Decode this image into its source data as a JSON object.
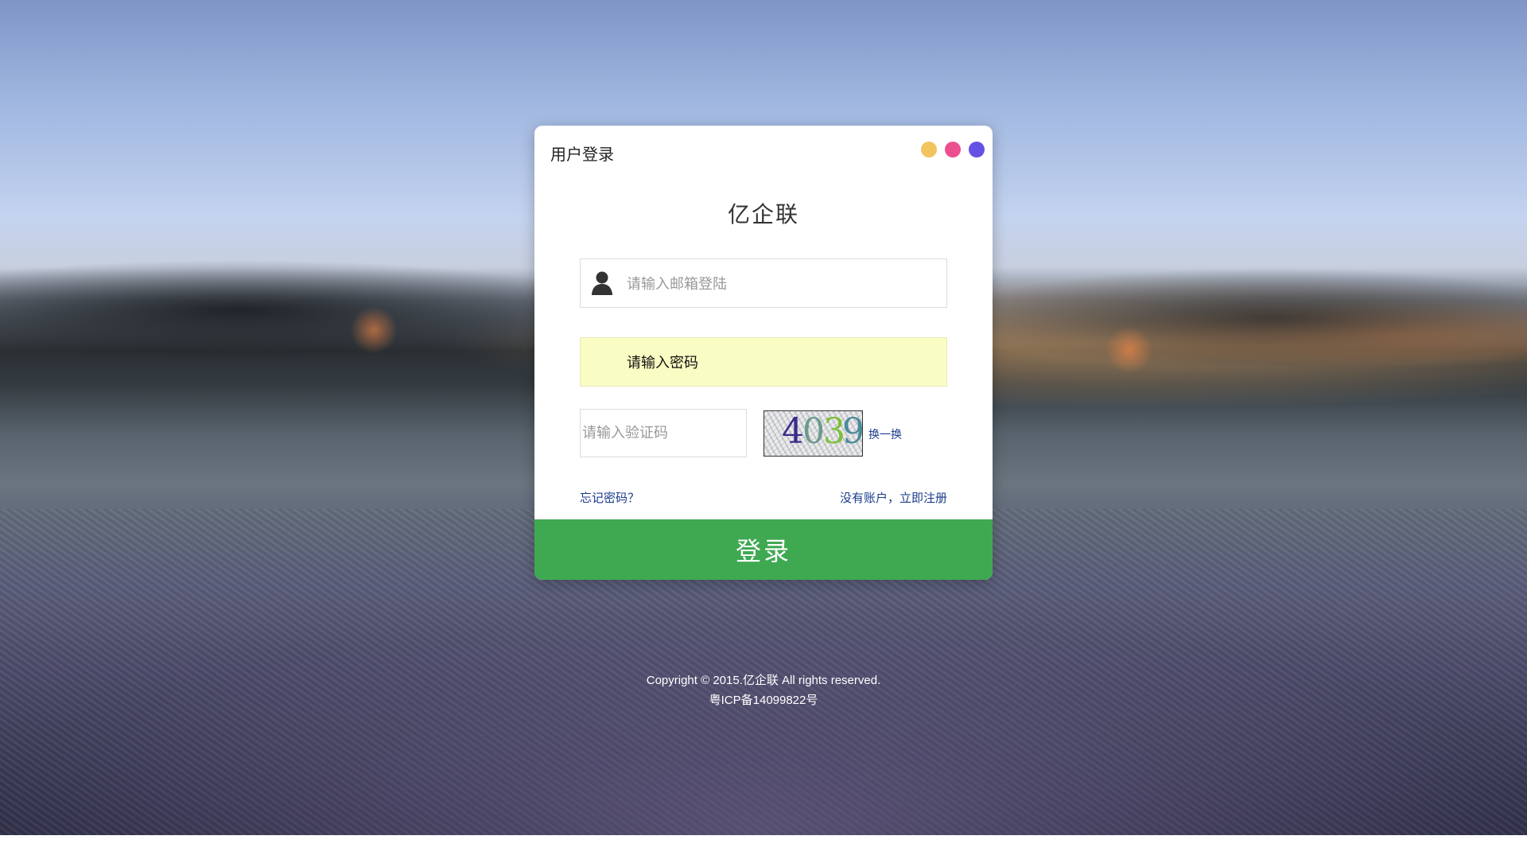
{
  "login": {
    "window_title": "用户登录",
    "brand": "亿企联",
    "email_placeholder": "请输入邮箱登陆",
    "password_placeholder": "请输入密码",
    "captcha_placeholder": "请输入验证码",
    "captcha_code": [
      "4",
      "0",
      "3",
      "9"
    ],
    "refresh_captcha": "换一换",
    "forgot_password": "忘记密码？",
    "register": "没有账户，立即注册",
    "submit": "登录"
  },
  "window_dots": {
    "colors": [
      "#f1c45d",
      "#ec4f8f",
      "#6552e4"
    ]
  },
  "footer": {
    "copyright": "Copyright © 2015.亿企联 All rights reserved.",
    "icp": "粤ICP备14099822号"
  },
  "colors": {
    "accent_green": "#3fa952",
    "password_highlight": "#fafdc3",
    "link_blue": "#1a3b8c"
  }
}
